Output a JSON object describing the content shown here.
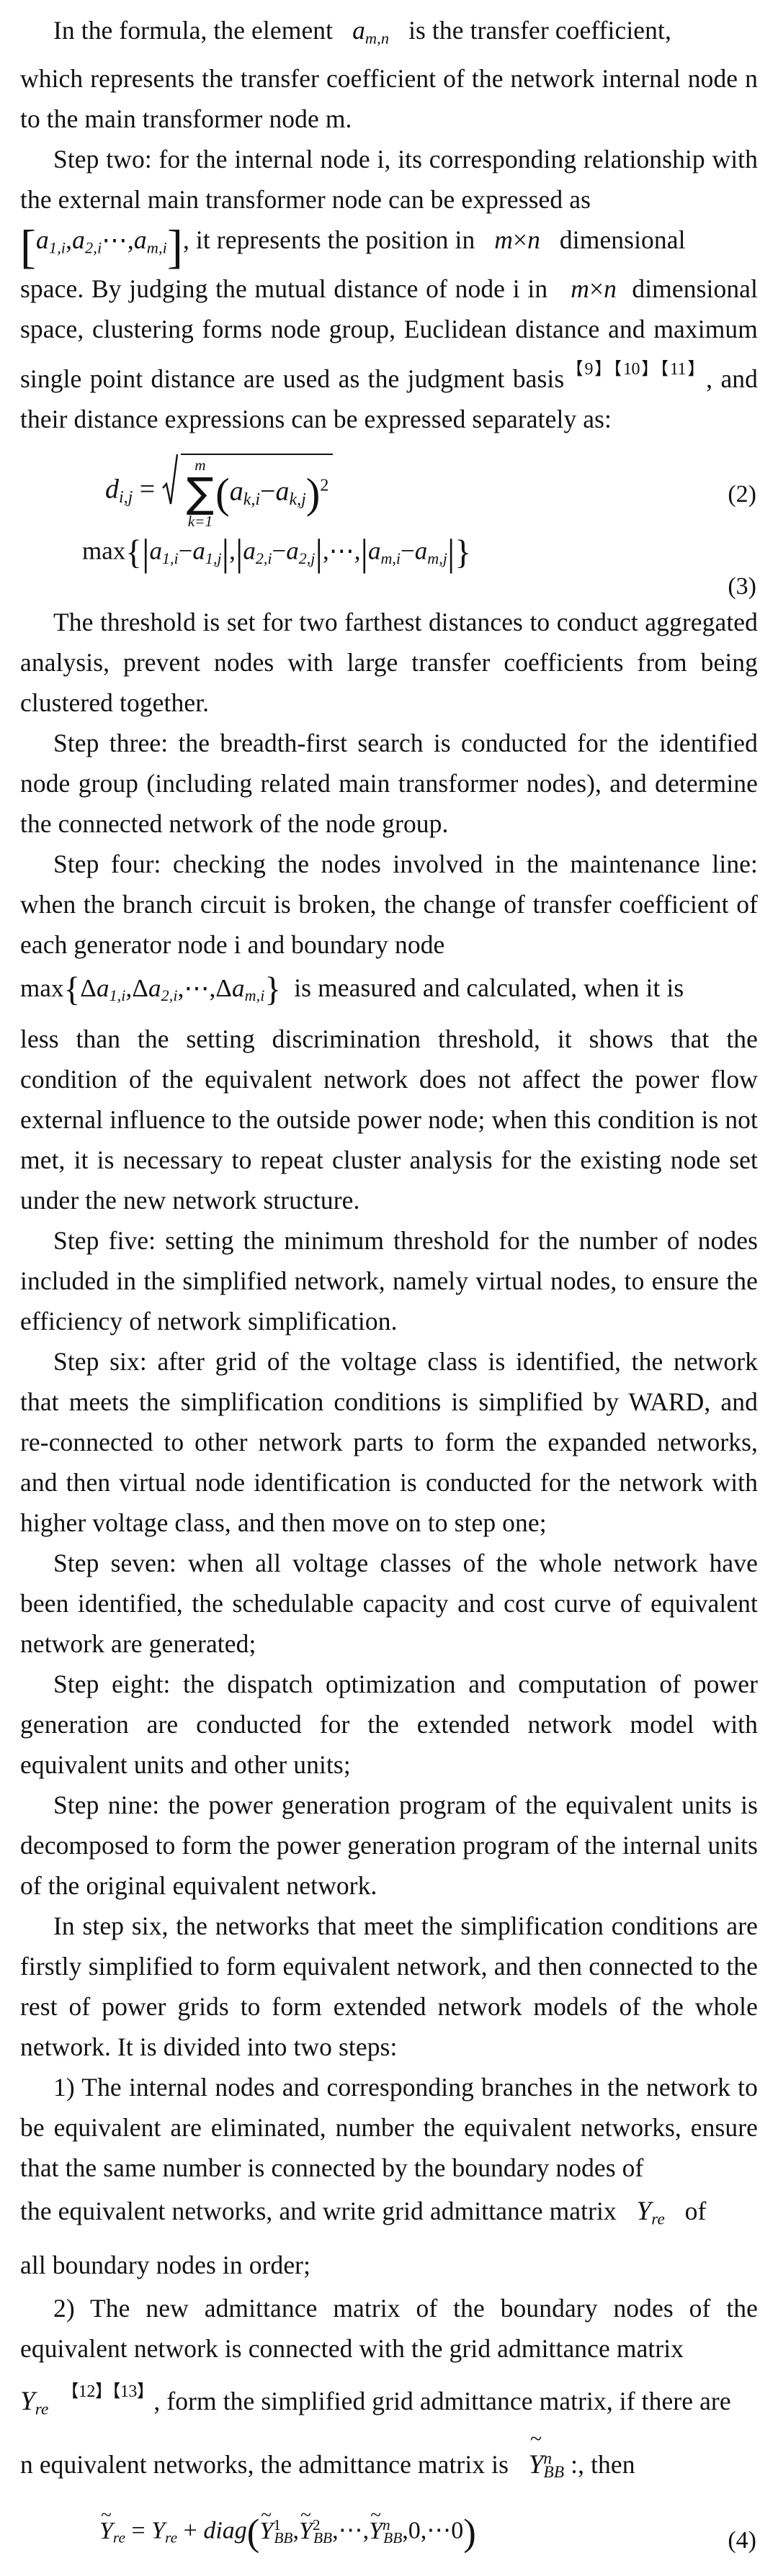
{
  "document": {
    "type": "academic-paper-body-page",
    "language": "en",
    "background_color": "#ffffff",
    "text_color": "#111111"
  },
  "paragraphs": {
    "p1_pre": "In the formula, the element",
    "p1_math": "a_{m,n}",
    "p1_post": "is the transfer coefficient,",
    "p2": "which represents the transfer coefficient of the network internal node n to the main transformer node m.",
    "p3_a": "Step two: for the internal node i, its corresponding relationship with the external main transformer node can be expressed as",
    "p3_bracket": "[a_{1,i}, a_{2,i} ⋯ , a_{m,i}]",
    "p3_b": ", it represents the position in",
    "p3_mn": "m × n",
    "p3_c": "dimensional",
    "p4_a": "space. By judging the mutual distance of node i in",
    "p4_mn": "m × n",
    "p4_b": "dimensional space, clustering forms node group, Euclidean distance and maximum single point distance are used as the judgment basis",
    "p4_cites": "【9】【10】【11】",
    "p4_c": ", and their distance expressions can be expressed separately as:",
    "p5": "The threshold is set for two farthest distances to conduct aggregated analysis, prevent nodes with large transfer coefficients from being clustered together.",
    "p6": "Step three: the breadth-first search is conducted for the identified node group (including related main transformer nodes), and determine the connected network of the node group.",
    "p7_a": "Step four: checking the nodes involved in the maintenance line: when the branch circuit is broken, the change of transfer coefficient of each generator node i and boundary node",
    "p7_math": "max{Δa_{1,i}, Δa_{2,i}, ⋯ , Δa_{m,i}}",
    "p7_b": "is measured and calculated, when it is",
    "p8": "less than the setting discrimination threshold, it shows that the condition of the equivalent network does not affect the power flow external influence to the outside power node; when this condition is not met, it is necessary to repeat cluster analysis for the existing node set under the new network structure.",
    "p9": "Step five: setting the minimum threshold for the number of nodes included in the simplified network, namely virtual nodes, to ensure the efficiency of network simplification.",
    "p10": "Step six: after grid of the voltage class is identified, the network that meets the simplification conditions is simplified by WARD, and re-connected to other network parts to form the expanded networks, and then virtual node identification is conducted for the network with higher voltage class, and then move on to step one;",
    "p11": "Step seven: when all voltage classes of the whole network have been identified, the schedulable capacity and cost curve of equivalent network are generated;",
    "p12": "Step eight: the dispatch optimization and computation of power generation are conducted for the extended network model with equivalent units and other units;",
    "p13": "Step nine: the power generation program of the equivalent units is decomposed to form the power generation program of the internal units of the original equivalent network.",
    "p14": "In step six, the networks that meet the simplification conditions are firstly simplified to form equivalent network, and then connected to the rest of power grids to form extended network models of the whole network. It is divided into two steps:",
    "p15_a": "1) The internal nodes and corresponding branches in the network to be equivalent are eliminated, number the equivalent networks, ensure that the same number is connected by the boundary nodes of",
    "p15_b": "the equivalent networks, and write grid admittance matrix",
    "p15_math": "Y_{re}",
    "p15_c": "of",
    "p15_d": "all boundary nodes in order;",
    "p16_a": "2) The new admittance matrix of the boundary nodes of the equivalent network is connected with the grid admittance matrix",
    "p16_math": "Y_{re}",
    "p16_cites": "【12】【13】",
    "p16_b": ", form the simplified grid admittance matrix, if there are",
    "p17_a": "n equivalent networks, the admittance matrix is",
    "p17_math": "Ỹ^{n}_{BB}",
    "p17_b": ":, then"
  },
  "equations": [
    {
      "id": "eq2",
      "number": "(2)",
      "latex": "d_{i,j} = \\sqrt{\\sum_{k=1}^{m}\\left(a_{k,i}-a_{k,j}\\right)^{2}}",
      "lhs": "d",
      "lhs_sub": "i,j",
      "sum_upper": "m",
      "sum_lower": "k=1",
      "term_a": "a",
      "term_a_sub": "k,i",
      "term_b": "a",
      "term_b_sub": "k,j",
      "power": "2"
    },
    {
      "id": "eq3",
      "number": "(3)",
      "latex": "\\max\\{|a_{1,i}-a_{1,j}|,|a_{2,i}-a_{2,j}|,\\cdots,|a_{m,i}-a_{m,j}|\\}",
      "op": "max",
      "terms": [
        {
          "left": "a",
          "left_sub": "1,i",
          "right": "a",
          "right_sub": "1,j"
        },
        {
          "left": "a",
          "left_sub": "2,i",
          "right": "a",
          "right_sub": "2,j"
        },
        {
          "left": "a",
          "left_sub": "m,i",
          "right": "a",
          "right_sub": "m,j"
        }
      ],
      "ellipsis": "⋯"
    },
    {
      "id": "eq4",
      "number": "(4)",
      "latex": "\\tilde{Y}_{re} = Y_{re} + diag\\left(\\tilde{Y}^{1}_{BB},\\tilde{Y}^{2}_{BB},\\cdots,\\tilde{Y}^{n}_{BB},0,\\cdots 0\\right)",
      "lhs": "Y",
      "lhs_sub": "re",
      "rhs_first": "Y",
      "rhs_first_sub": "re",
      "func": "diag",
      "args": [
        "Y^1_BB",
        "Y^2_BB",
        "Y^n_BB",
        "0",
        "⋯0"
      ],
      "ellipsis": "⋯"
    }
  ],
  "symbols": {
    "a": "a",
    "Y": "Y",
    "d": "d",
    "m": "m",
    "n": "n",
    "i": "i",
    "j": "j",
    "k": "k",
    "delta": "Δ",
    "sigma": "∑",
    "times": "×",
    "minus": "−",
    "plus": "+",
    "equals": "=",
    "ellipsis": "⋯",
    "tilde": "~",
    "comma": ",",
    "BB": "BB",
    "re": "re",
    "diag": "diag",
    "max": "max"
  },
  "inline_text": {
    "comma": ", ",
    "space": " "
  }
}
